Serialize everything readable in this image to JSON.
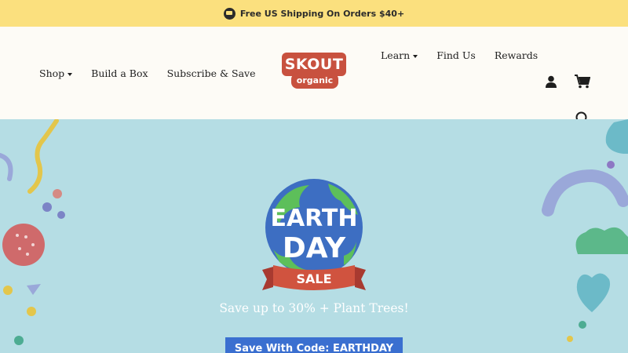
{
  "announcement": {
    "text": "Free US Shipping On Orders $40+",
    "icon": "truck-icon"
  },
  "header": {
    "nav_left": [
      "Shop",
      "Build a Box",
      "Subscribe & Save"
    ],
    "nav_right": [
      "Learn",
      "Find Us",
      "Rewards"
    ],
    "logo": {
      "line1": "SKOUT",
      "line2": "organic"
    },
    "icons": [
      "user-icon",
      "cart-icon",
      "search-icon"
    ]
  },
  "hero": {
    "badge": {
      "word1": "EARTH",
      "word2": "DAY",
      "ribbon": "SALE"
    },
    "tagline": "Save up to 30% + Plant Trees!",
    "cta_label": "Save With Code: EARTHDAY"
  },
  "colors": {
    "announcement_bg": "#fbe07e",
    "header_bg": "#fdfbf6",
    "hero_bg": "#b5dde4",
    "brand_red": "#c8513f",
    "cta_blue": "#3a6fd0"
  }
}
